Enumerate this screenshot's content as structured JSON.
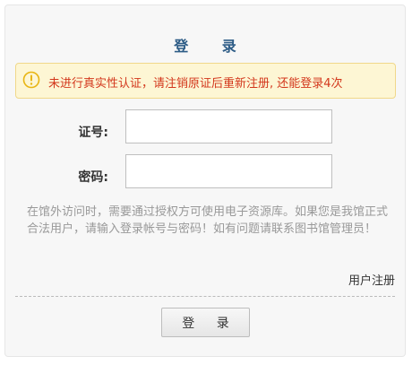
{
  "login": {
    "title": "登 录",
    "alert": {
      "icon": "info-circle-icon",
      "text": "未进行真实性认证，请注销原证后重新注册, 还能登录4次",
      "color": "#d3371c",
      "background": "#fdf6d4"
    },
    "fields": {
      "card_label": "证号:",
      "card_value": "",
      "password_label": "密码:",
      "password_value": ""
    },
    "notice": "在馆外访问时，需要通过授权方可使用电子资源库。如果您是我馆正式合法用户，请输入登录帐号与密码！如有问题请联系图书馆管理员！",
    "register_link": "用户注册",
    "submit_label": "登 录",
    "colors": {
      "title": "#2d5c86",
      "notice": "#999999"
    }
  }
}
